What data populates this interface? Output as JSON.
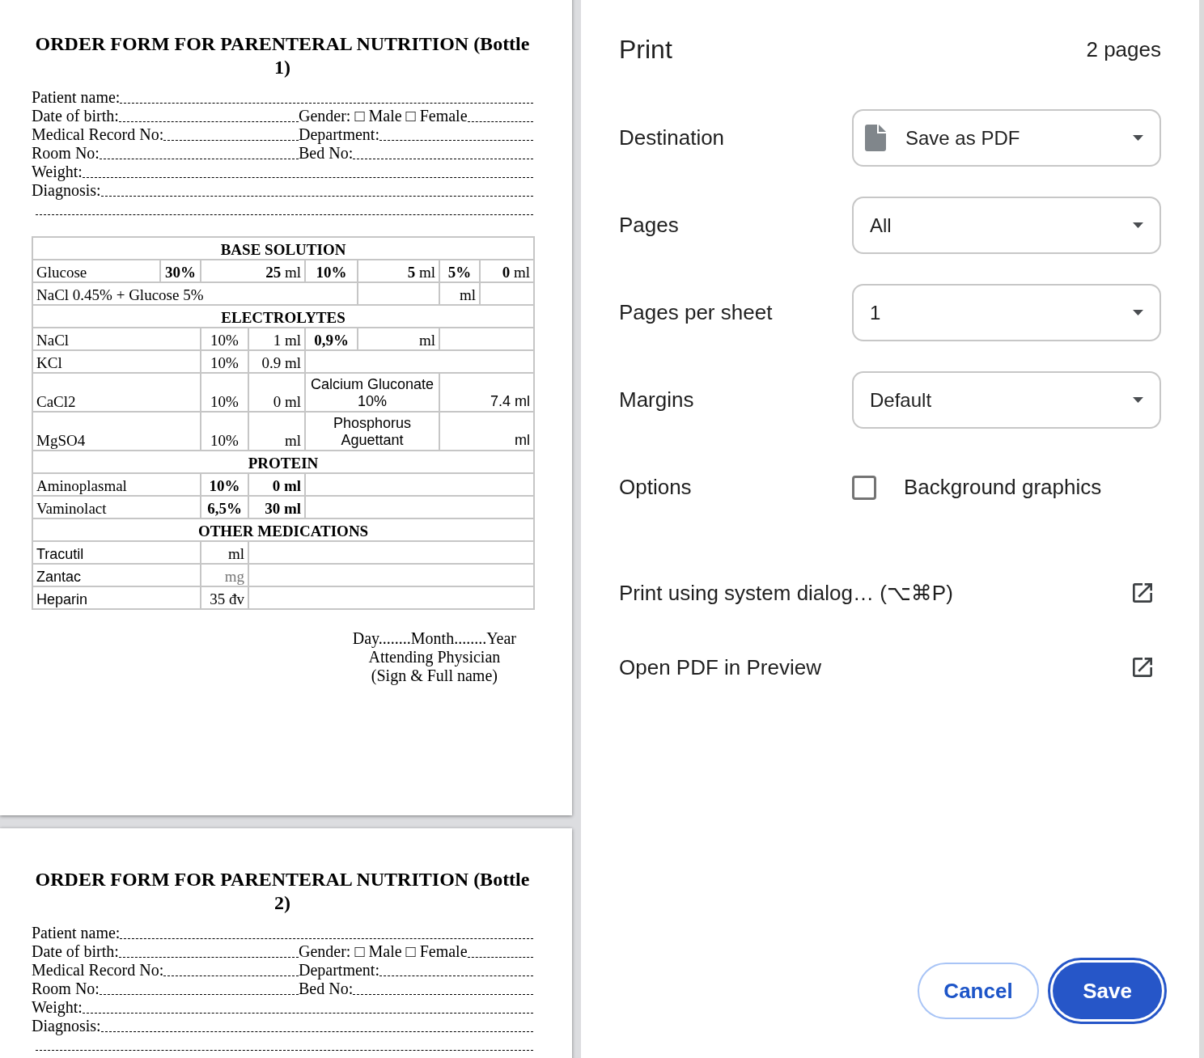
{
  "preview": {
    "pages": [
      {
        "title": "ORDER FORM FOR PARENTERAL NUTRITION (Bottle 1)",
        "fields": [
          {
            "cells": [
              "Patient name:"
            ]
          },
          {
            "cells": [
              "Date of birth:",
              "Gender: □ Male □ Female"
            ]
          },
          {
            "cells": [
              "Medical Record No:",
              "Department:"
            ]
          },
          {
            "cells": [
              "Room No:",
              "Bed No:"
            ]
          },
          {
            "cells": [
              "Weight:"
            ]
          },
          {
            "cells": [
              "Diagnosis:"
            ]
          }
        ],
        "table": {
          "rows": [
            {
              "kind": "section",
              "cells": [
                {
                  "text": "BASE SOLUTION",
                  "colspan": 8
                }
              ]
            },
            {
              "kind": "concentrations",
              "cells": [
                {
                  "text": "Glucose"
                },
                {
                  "text": "30%"
                },
                {
                  "text": "**25** ml",
                  "colspan": 2
                },
                {
                  "text": "10%"
                },
                {
                  "text": "**5** ml"
                },
                {
                  "text": "5%"
                },
                {
                  "text": "**0** ml"
                }
              ]
            },
            {
              "kind": "premix",
              "cells": [
                {
                  "text": "NaCl 0.45% + Glucose 5%",
                  "colspan": 5
                },
                {},
                {
                  "text": "ml"
                },
                {}
              ]
            },
            {
              "kind": "section",
              "cells": [
                {
                  "text": "ELECTROLYTES",
                  "colspan": 8
                }
              ]
            },
            {
              "kind": "paired",
              "cells": [
                {
                  "text": "NaCl",
                  "colspan": 2
                },
                {
                  "text": "10%"
                },
                {
                  "text": "1 ml"
                },
                {
                  "text": "0,9%"
                },
                {
                  "text": "ml"
                },
                {
                  "colspan": 2
                }
              ]
            },
            {
              "kind": "single",
              "cells": [
                {
                  "text": "KCl",
                  "colspan": 2
                },
                {
                  "text": "10%"
                },
                {
                  "text": "0.9 ml"
                },
                {
                  "colspan": 4
                }
              ]
            },
            {
              "kind": "additive",
              "cells": [
                {
                  "text": "CaCl2",
                  "colspan": 2
                },
                {
                  "text": "10%"
                },
                {
                  "text": "0 ml"
                },
                {
                  "text": "Calcium Gluconate 10%",
                  "colspan": 2
                },
                {
                  "text": "7.4 ml",
                  "colspan": 2
                }
              ]
            },
            {
              "kind": "additive",
              "cells": [
                {
                  "text": "MgSO4",
                  "colspan": 2
                },
                {
                  "text": "10%"
                },
                {
                  "text": "ml"
                },
                {
                  "text": "Phosphorus Aguettant",
                  "colspan": 2
                },
                {
                  "text": "ml",
                  "colspan": 2
                }
              ]
            },
            {
              "kind": "section",
              "cells": [
                {
                  "text": "PROTEIN",
                  "colspan": 8
                }
              ]
            },
            {
              "kind": "protein",
              "cells": [
                {
                  "text": "Aminoplasmal",
                  "colspan": 2
                },
                {
                  "text": "10%"
                },
                {
                  "text": "0 ml"
                },
                {
                  "colspan": 4
                }
              ]
            },
            {
              "kind": "protein",
              "cells": [
                {
                  "text": "Vaminolact",
                  "colspan": 2
                },
                {
                  "text": "6,5%"
                },
                {
                  "text": "30 ml"
                },
                {
                  "colspan": 4
                }
              ]
            },
            {
              "kind": "section",
              "cells": [
                {
                  "text": "OTHER MEDICATIONS",
                  "colspan": 8
                }
              ]
            },
            {
              "kind": "medication",
              "cells": [
                {
                  "text": "Tracutil",
                  "colspan": 2
                },
                {
                  "text": "ml"
                },
                {
                  "colspan": 5
                }
              ],
              "unit_greyed": false
            },
            {
              "kind": "medication",
              "cells": [
                {
                  "text": "Zantac",
                  "colspan": 2
                },
                {
                  "text": "mg"
                },
                {
                  "colspan": 5
                }
              ],
              "unit_greyed": true
            },
            {
              "kind": "medication",
              "cells": [
                {
                  "text": "Heparin",
                  "colspan": 2
                },
                {
                  "text": "35 đv"
                },
                {
                  "colspan": 5
                }
              ],
              "unit_greyed": false
            }
          ]
        },
        "signature": [
          "Day........Month........Year",
          "Attending Physician",
          "(Sign & Full name)"
        ]
      },
      {
        "title": "ORDER FORM FOR PARENTERAL NUTRITION (Bottle 2)",
        "fields": [
          {
            "cells": [
              "Patient name:"
            ]
          },
          {
            "cells": [
              "Date of birth:",
              "Gender: □ Male □ Female"
            ]
          },
          {
            "cells": [
              "Medical Record No:",
              "Department:"
            ]
          },
          {
            "cells": [
              "Room No:",
              "Bed No:"
            ]
          },
          {
            "cells": [
              "Weight:"
            ]
          },
          {
            "cells": [
              "Diagnosis:"
            ]
          }
        ]
      }
    ]
  },
  "dialog": {
    "title": "Print",
    "page_count": "2 pages",
    "settings": [
      {
        "kind": "destination",
        "label": "Destination",
        "value": "Save as PDF"
      },
      {
        "kind": "select",
        "label": "Pages",
        "value": "All"
      },
      {
        "kind": "select",
        "label": "Pages per sheet",
        "value": "1"
      },
      {
        "kind": "select",
        "label": "Margins",
        "value": "Default"
      },
      {
        "kind": "checkbox",
        "label": "Options",
        "option": "Background graphics",
        "checked": false
      }
    ],
    "links": [
      "Print using system dialog… (⌥⌘P)",
      "Open PDF in Preview"
    ],
    "buttons": [
      {
        "kind": "secondary",
        "label": "Cancel",
        "focused": false
      },
      {
        "kind": "primary",
        "label": "Save",
        "focused": true
      }
    ]
  }
}
